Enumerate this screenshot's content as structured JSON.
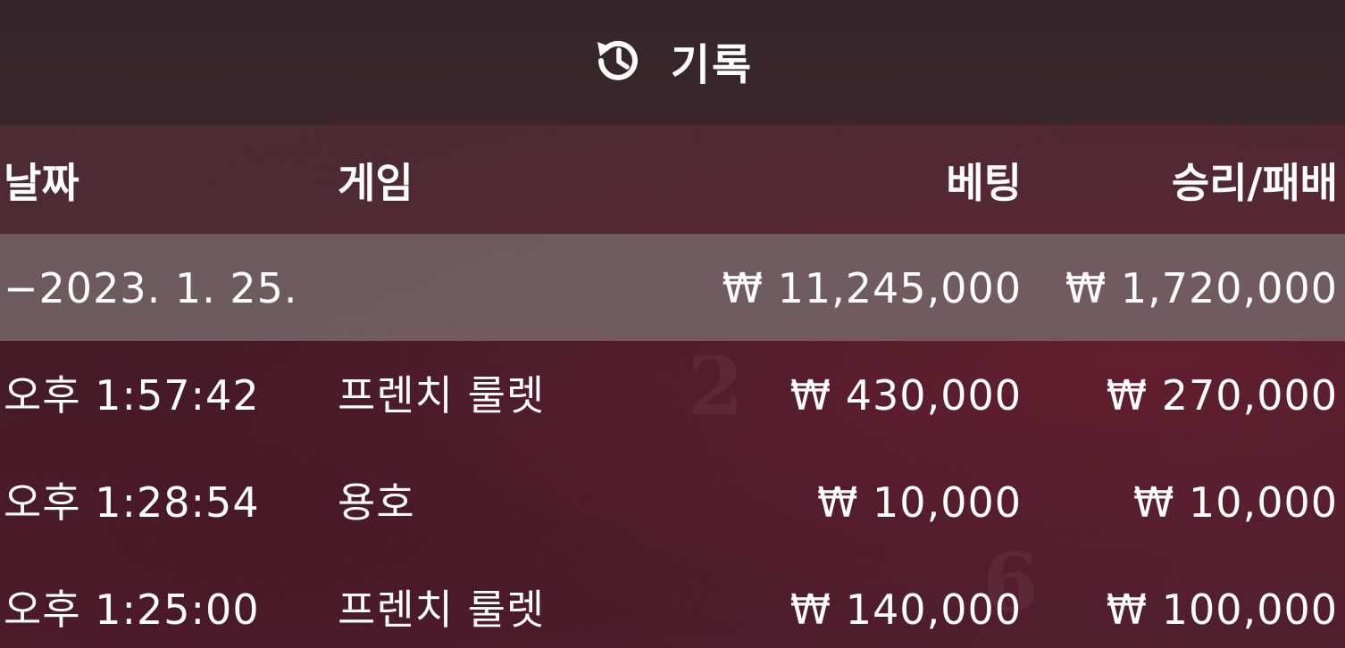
{
  "header": {
    "title": "기록",
    "icon": "history-icon"
  },
  "table": {
    "columns": {
      "date": "날짜",
      "game": "게임",
      "bet": "베팅",
      "win_loss": "승리/패배"
    },
    "summary": {
      "date": "−2023. 1. 25.",
      "bet": "₩ 11,245,000",
      "win_loss": "₩ 1,720,000"
    },
    "rows": [
      {
        "time": "오후 1:57:42",
        "game": "프렌치 룰렛",
        "bet": "₩ 430,000",
        "win_loss": "₩ 270,000"
      },
      {
        "time": "오후 1:28:54",
        "game": "용호",
        "bet": "₩ 10,000",
        "win_loss": "₩ 10,000"
      },
      {
        "time": "오후 1:25:00",
        "game": "프렌치 룰렛",
        "bet": "₩ 140,000",
        "win_loss": "₩ 100,000"
      }
    ]
  }
}
